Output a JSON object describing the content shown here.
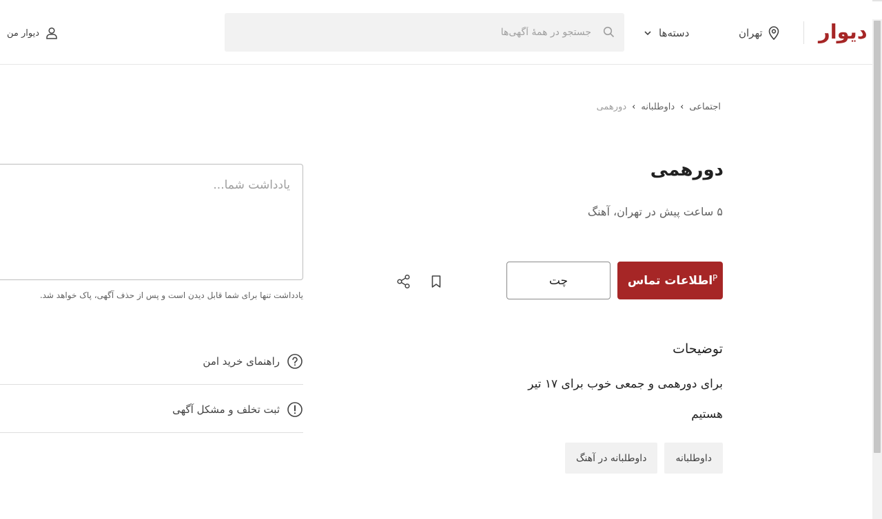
{
  "header": {
    "logo": "دیوار",
    "city": "تهران",
    "categories_label": "دسته‌ها",
    "search_placeholder": "جستجو در همهٔ آگهی‌ها",
    "my_divar": "دیوار من"
  },
  "breadcrumb": {
    "items": [
      "اجتماعی",
      "داوطلبانه",
      "دورهمی"
    ]
  },
  "post": {
    "title": "دورهمی",
    "subtitle": "۵ ساعت پیش در تهران، آهنگ",
    "contact_label": "اطلاعات تماس",
    "contact_extra": "P",
    "chat_label": "چت",
    "description_heading": "توضیحات",
    "description_lines": [
      "برای دورهمی و جمعی خوب برای ۱۷ تیر",
      "هستیم"
    ],
    "tags": [
      "داوطلبانه",
      "داوطلبانه در آهنگ"
    ]
  },
  "note": {
    "placeholder": "یادداشت شما...",
    "hint": "یادداشت تنها برای شما قابل دیدن است و پس از حذف آگهی، پاک خواهد شد."
  },
  "links": {
    "safe_guide": "راهنمای خرید امن",
    "report": "ثبت تخلف و مشکل آگهی"
  },
  "colors": {
    "brand": "#a62626",
    "text": "#212121",
    "muted": "#616161"
  }
}
